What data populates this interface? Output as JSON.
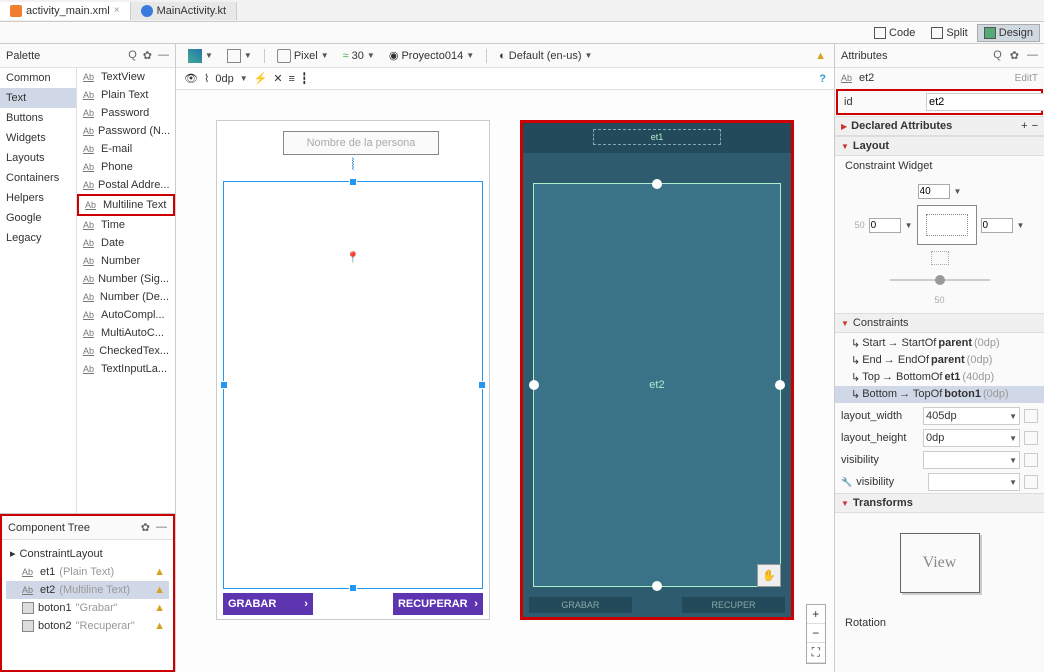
{
  "tabs": {
    "active": "activity_main.xml",
    "inactive": "MainActivity.kt"
  },
  "view_modes": [
    "Code",
    "Split",
    "Design"
  ],
  "palette": {
    "title": "Palette",
    "categories": [
      "Common",
      "Text",
      "Buttons",
      "Widgets",
      "Layouts",
      "Containers",
      "Helpers",
      "Google",
      "Legacy"
    ],
    "selected_category": "Text",
    "items": [
      "TextView",
      "Plain Text",
      "Password",
      "Password (N...",
      "E-mail",
      "Phone",
      "Postal Addre...",
      "Multiline Text",
      "Time",
      "Date",
      "Number",
      "Number (Sig...",
      "Number (De...",
      "AutoCompl...",
      "MultiAutoC...",
      "CheckedTex...",
      "TextInputLa..."
    ],
    "highlighted_item": "Multiline Text"
  },
  "component_tree": {
    "title": "Component Tree",
    "root": "ConstraintLayout",
    "children": [
      {
        "id": "et1",
        "type": "(Plain Text)",
        "warn": true
      },
      {
        "id": "et2",
        "type": "(Multiline Text)",
        "warn": true,
        "selected": true
      },
      {
        "id": "boton1",
        "text": "\"Grabar\"",
        "warn": true
      },
      {
        "id": "boton2",
        "text": "\"Recuperar\"",
        "warn": true
      }
    ]
  },
  "toolbar": {
    "device": "Pixel",
    "api": "30",
    "theme": "Proyecto014",
    "locale": "Default (en-us)"
  },
  "sub_toolbar": {
    "margin": "0dp"
  },
  "design": {
    "hint": "Nombre de la persona",
    "btn1": "GRABAR",
    "btn2": "RECUPERAR"
  },
  "blueprint": {
    "et1": "et1",
    "et2": "et2",
    "btn1": "GRABAR",
    "btn2": "RECUPER"
  },
  "attributes": {
    "title": "Attributes",
    "component_type": "et2",
    "edit_hint": "EditT",
    "id_label": "id",
    "id_value": "et2",
    "sections": {
      "declared": "Declared Attributes",
      "layout": "Layout",
      "constraint_widget": "Constraint Widget",
      "constraints": "Constraints",
      "transforms": "Transforms"
    },
    "cw": {
      "top": "40",
      "left": "0",
      "right": "0",
      "bottom_slider": "50",
      "side_dot": "50"
    },
    "constraints_list": [
      {
        "side": "Start",
        "rel": "→ StartOf",
        "target": "parent",
        "val": "(0dp)"
      },
      {
        "side": "End",
        "rel": "→ EndOf",
        "target": "parent",
        "val": "(0dp)"
      },
      {
        "side": "Top",
        "rel": "→ BottomOf",
        "target": "et1",
        "val": "(40dp)"
      },
      {
        "side": "Bottom",
        "rel": "→ TopOf",
        "target": "boton1",
        "val": "(0dp)",
        "selected": true
      }
    ],
    "layout_width": {
      "label": "layout_width",
      "value": "405dp"
    },
    "layout_height": {
      "label": "layout_height",
      "value": "0dp"
    },
    "visibility": {
      "label": "visibility",
      "value": ""
    },
    "f_visibility": {
      "label": "visibility",
      "value": ""
    },
    "view_preview": "View",
    "rotation": "Rotation"
  }
}
